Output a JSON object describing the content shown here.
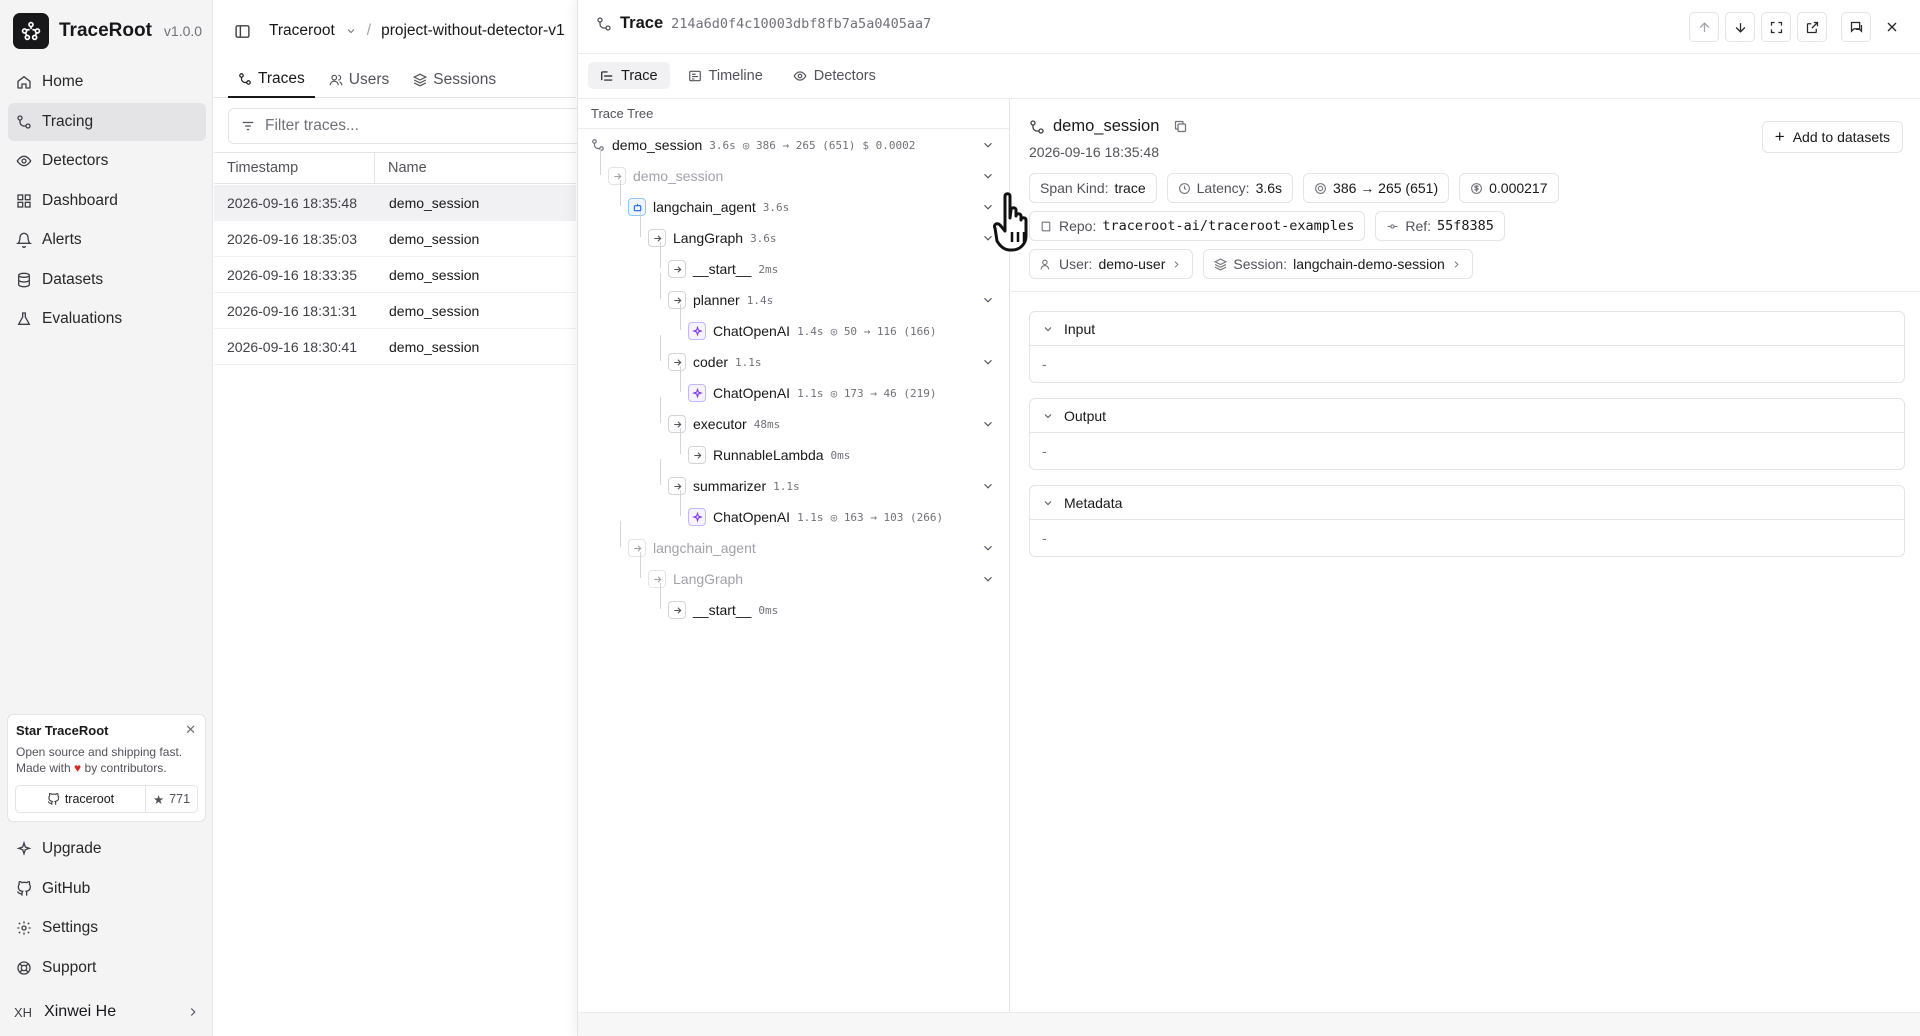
{
  "app": {
    "name": "TraceRoot",
    "version": "v1.0.0"
  },
  "sidebar": {
    "nav": [
      {
        "label": "Home",
        "icon": "home-icon"
      },
      {
        "label": "Tracing",
        "icon": "tracing-icon",
        "active": true
      },
      {
        "label": "Detectors",
        "icon": "eye-icon"
      },
      {
        "label": "Dashboard",
        "icon": "dashboard-icon"
      },
      {
        "label": "Alerts",
        "icon": "bell-icon"
      },
      {
        "label": "Datasets",
        "icon": "database-icon"
      },
      {
        "label": "Evaluations",
        "icon": "flask-icon"
      }
    ],
    "promo": {
      "title": "Star TraceRoot",
      "text1": "Open source and shipping fast.",
      "text2_prefix": "Made with",
      "text2_suffix": "by contributors.",
      "repo_label": "traceroot",
      "stars": "771"
    },
    "bottom_nav": [
      {
        "label": "Upgrade",
        "icon": "sparkle-icon"
      },
      {
        "label": "GitHub",
        "icon": "github-icon"
      },
      {
        "label": "Settings",
        "icon": "gear-icon"
      },
      {
        "label": "Support",
        "icon": "lifebuoy-icon"
      }
    ],
    "user": {
      "initials": "XH",
      "name": "Xinwei He"
    }
  },
  "traces_panel": {
    "breadcrumb": {
      "org": "Traceroot",
      "project": "project-without-detector-v1"
    },
    "tabs": [
      {
        "label": "Traces",
        "active": true
      },
      {
        "label": "Users",
        "active": false
      },
      {
        "label": "Sessions",
        "active": false
      }
    ],
    "filter_placeholder": "Filter traces...",
    "columns": {
      "timestamp": "Timestamp",
      "name": "Name"
    },
    "rows": [
      {
        "timestamp": "2026-09-16 18:35:48",
        "name": "demo_session",
        "selected": true
      },
      {
        "timestamp": "2026-09-16 18:35:03",
        "name": "demo_session",
        "selected": false
      },
      {
        "timestamp": "2026-09-16 18:33:35",
        "name": "demo_session",
        "selected": false
      },
      {
        "timestamp": "2026-09-16 18:31:31",
        "name": "demo_session",
        "selected": false
      },
      {
        "timestamp": "2026-09-16 18:30:41",
        "name": "demo_session",
        "selected": false
      }
    ]
  },
  "detail": {
    "title": "Trace",
    "trace_id": "214a6d0f4c10003dbf8fb7a5a0405aa7",
    "tabs": [
      {
        "label": "Trace",
        "active": true
      },
      {
        "label": "Timeline",
        "active": false
      },
      {
        "label": "Detectors",
        "active": false
      }
    ],
    "tree_label": "Trace Tree",
    "root": {
      "name": "demo_session",
      "dur": "3.6s",
      "tokens": "386 → 265 (651)",
      "cost": "0.0002"
    },
    "tree": [
      {
        "name": "demo_session",
        "dur": "",
        "tokens": "",
        "kind": "chain",
        "depth": 1,
        "dim": true,
        "chev": true
      },
      {
        "name": "langchain_agent",
        "dur": "3.6s",
        "tokens": "",
        "kind": "agent",
        "depth": 2,
        "dim": false,
        "chev": true
      },
      {
        "name": "LangGraph",
        "dur": "3.6s",
        "tokens": "",
        "kind": "chain",
        "depth": 3,
        "dim": false,
        "chev": true
      },
      {
        "name": "__start__",
        "dur": "2ms",
        "tokens": "",
        "kind": "chain",
        "depth": 4,
        "dim": false,
        "chev": false
      },
      {
        "name": "planner",
        "dur": "1.4s",
        "tokens": "",
        "kind": "chain",
        "depth": 4,
        "dim": false,
        "chev": true
      },
      {
        "name": "ChatOpenAI",
        "dur": "1.4s",
        "tokens": "50 → 116 (166)",
        "kind": "llm",
        "depth": 5,
        "dim": false,
        "chev": false
      },
      {
        "name": "coder",
        "dur": "1.1s",
        "tokens": "",
        "kind": "chain",
        "depth": 4,
        "dim": false,
        "chev": true
      },
      {
        "name": "ChatOpenAI",
        "dur": "1.1s",
        "tokens": "173 → 46 (219)",
        "kind": "llm",
        "depth": 5,
        "dim": false,
        "chev": false
      },
      {
        "name": "executor",
        "dur": "48ms",
        "tokens": "",
        "kind": "chain",
        "depth": 4,
        "dim": false,
        "chev": true
      },
      {
        "name": "RunnableLambda",
        "dur": "0ms",
        "tokens": "",
        "kind": "chain",
        "depth": 5,
        "dim": false,
        "chev": false
      },
      {
        "name": "summarizer",
        "dur": "1.1s",
        "tokens": "",
        "kind": "chain",
        "depth": 4,
        "dim": false,
        "chev": true
      },
      {
        "name": "ChatOpenAI",
        "dur": "1.1s",
        "tokens": "163 → 103 (266)",
        "kind": "llm",
        "depth": 5,
        "dim": false,
        "chev": false
      },
      {
        "name": "langchain_agent",
        "dur": "",
        "tokens": "",
        "kind": "chain",
        "depth": 2,
        "dim": true,
        "chev": true
      },
      {
        "name": "LangGraph",
        "dur": "",
        "tokens": "",
        "kind": "chain",
        "depth": 3,
        "dim": true,
        "chev": true
      },
      {
        "name": "__start__",
        "dur": "0ms",
        "tokens": "",
        "kind": "chain",
        "depth": 4,
        "dim": false,
        "chev": false
      }
    ],
    "span": {
      "name": "demo_session",
      "timestamp": "2026-09-16 18:35:48",
      "add_label": "Add to datasets",
      "kind_label": "Span Kind:",
      "kind": "trace",
      "latency_label": "Latency:",
      "latency": "3.6s",
      "tokens": "386 → 265 (651)",
      "cost": "0.000217",
      "repo_label": "Repo:",
      "repo": "traceroot-ai/traceroot-examples",
      "ref_label": "Ref:",
      "ref": "55f8385",
      "user_label": "User:",
      "user": "demo-user",
      "session_label": "Session:",
      "session": "langchain-demo-session",
      "sections": [
        {
          "title": "Input",
          "value": "-"
        },
        {
          "title": "Output",
          "value": "-"
        },
        {
          "title": "Metadata",
          "value": "-"
        }
      ]
    }
  },
  "colors": {
    "accent": "#18181b",
    "llm": "#7c3aed",
    "agent": "#2563eb",
    "heart": "#dc2626"
  }
}
